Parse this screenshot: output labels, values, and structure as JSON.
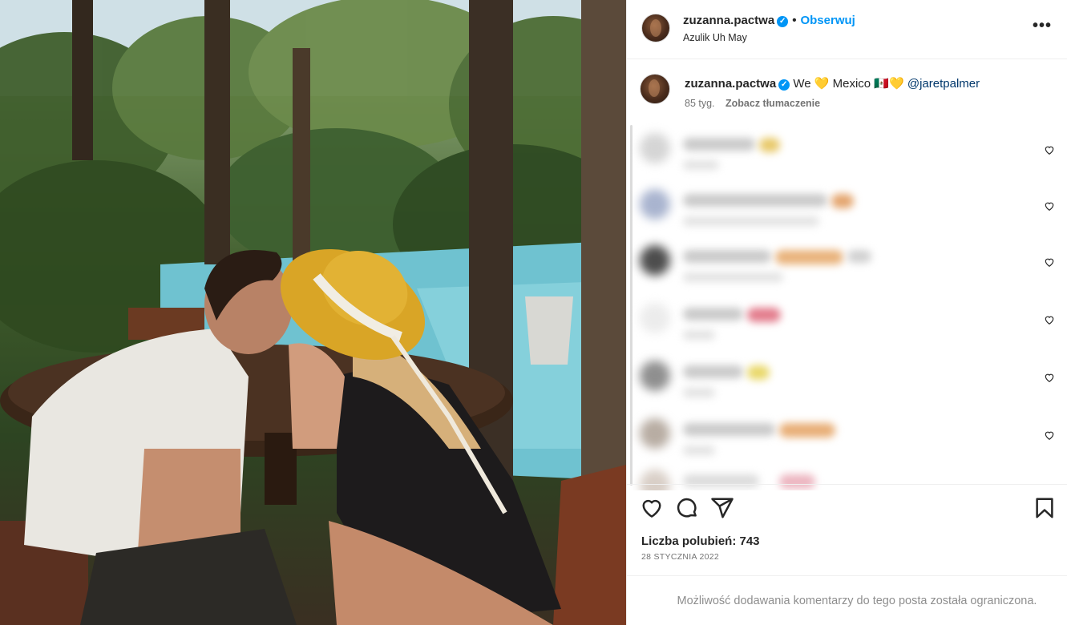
{
  "header": {
    "username": "zuzanna.pactwa",
    "separator": "•",
    "follow_label": "Obserwuj",
    "location": "Azulik Uh May",
    "more_label": "•••"
  },
  "caption": {
    "username": "zuzanna.pactwa",
    "text_before": "We",
    "heart1": "💛",
    "text_mid": "Mexico",
    "flag": "🇲🇽",
    "heart2": "💛",
    "mention": "@jaretpalmer",
    "age": "85 tyg.",
    "translate_label": "Zobacz tłumaczenie"
  },
  "comments_note": "blurred",
  "likes": "Liczba polubień: 743",
  "date": "28 STYCZNIA 2022",
  "restricted_text": "Możliwość dodawania komentarzy do tego posta została ograniczona.",
  "colors": {
    "accent": "#0095f6",
    "text": "#262626",
    "muted": "#737373",
    "border": "#efefef"
  },
  "icons": {
    "like": "heart-outline-icon",
    "comment": "speech-bubble-icon",
    "share": "paper-plane-icon",
    "save": "bookmark-icon",
    "verified": "verified-badge-icon"
  }
}
